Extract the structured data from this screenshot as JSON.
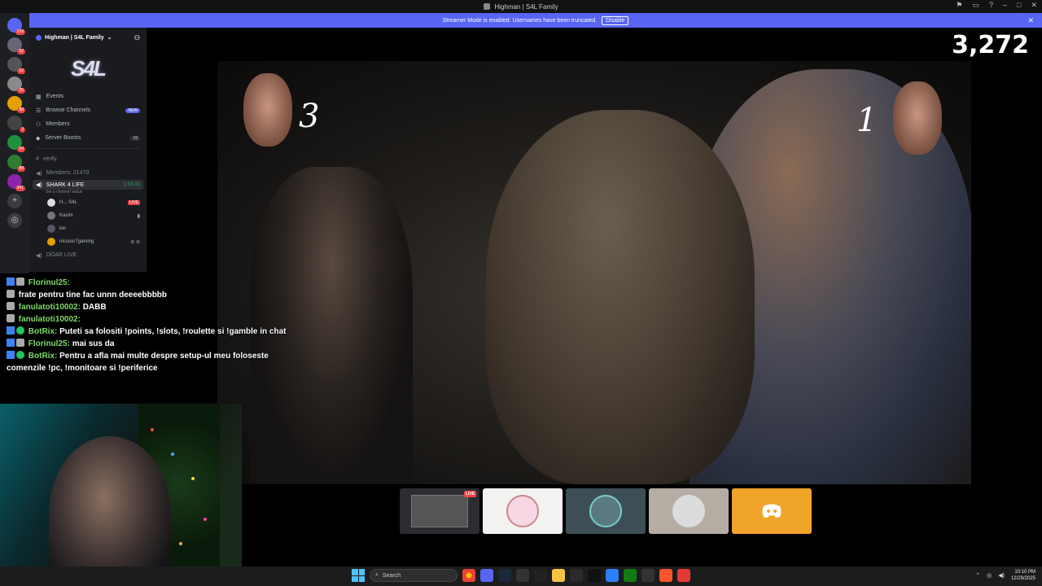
{
  "window": {
    "title": "Highman | S4L Family"
  },
  "streamer_bar": {
    "message": "Streamer Mode is enabled. Usernames have been truncated.",
    "disable_label": "Disable",
    "close_glyph": "✕"
  },
  "rail": {
    "servers": [
      {
        "badge": "129"
      },
      {
        "badge": "52"
      },
      {
        "badge": "12"
      },
      {
        "badge": "25"
      },
      {
        "badge": "88"
      },
      {
        "badge": "3"
      },
      {
        "badge": "24"
      },
      {
        "badge": "88"
      },
      {
        "badge": "341"
      }
    ],
    "add_glyph": "+",
    "explore_glyph": "◎"
  },
  "sidebar": {
    "guild_name": "Highman | S4L Family",
    "banner_text": "S4L",
    "menu": [
      {
        "label": "Events"
      },
      {
        "label": "Browse Channels",
        "badge": "NEW"
      },
      {
        "label": "Members"
      },
      {
        "label": "Server Boosts",
        "count": "19"
      }
    ],
    "channels": {
      "verify": "verify",
      "members_count": "Members: 21470",
      "voice_active": "SHARK 4 LIFE",
      "voice_timer": "1:54:31",
      "status_hint": "Set a channel status",
      "doar_live": "DOAR LIVE"
    },
    "voice_users": [
      {
        "name": "H... S4L",
        "live": "LIVE"
      },
      {
        "name": "Kasim"
      },
      {
        "name": "kei"
      },
      {
        "name": "nicusor7gaming"
      }
    ]
  },
  "viewer_count": "3,272",
  "video": {
    "rank_left": "3",
    "rank_right": "1"
  },
  "chat": [
    {
      "user": "Florinul25:",
      "text": ""
    },
    {
      "user": "",
      "text": "frate pentru tine fac unnn deeeebbbbb"
    },
    {
      "user": "fanulatoti10002:",
      "text": "DABB"
    },
    {
      "user": "fanulatoti10002:",
      "text": ""
    },
    {
      "user": "BotRix:",
      "text": "Puteti sa folositi !points, !slots, !roulette si !gamble in chat"
    },
    {
      "user": "Florinul25:",
      "text": "mai sus da"
    },
    {
      "user": "BotRix:",
      "text": "Pentru a afla mai multe despre setup-ul meu foloseste comenzile !pc, !monitoare si !periferice"
    }
  ],
  "tiles": [
    {
      "type": "screen",
      "live": "LIVE"
    },
    {
      "type": "avatar-pink"
    },
    {
      "type": "avatar-teal"
    },
    {
      "type": "avatar-car"
    },
    {
      "type": "discord"
    }
  ],
  "taskbar": {
    "search_placeholder": "Search",
    "time": "10:10 PM",
    "date": "12/29/2025"
  },
  "colors": {
    "accent": "#5865f2",
    "live": "#ed4245",
    "chat_user": "#7fd86a",
    "discord_tile": "#f0a42a"
  }
}
